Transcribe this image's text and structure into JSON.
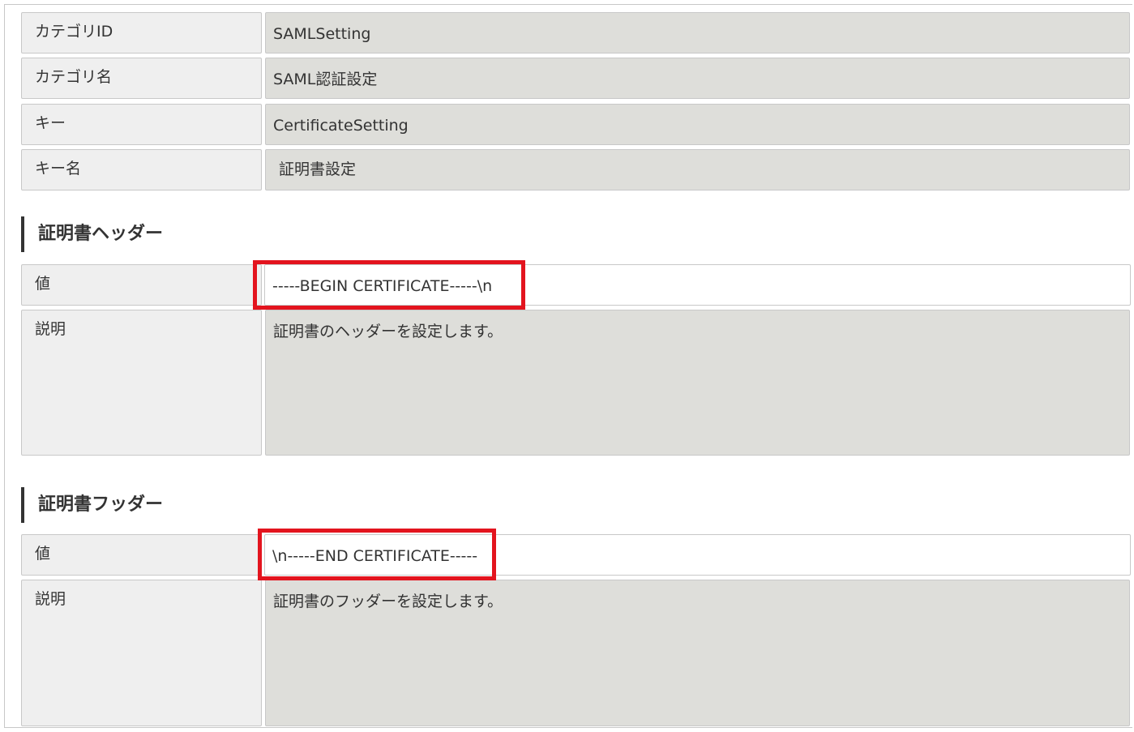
{
  "fields": {
    "category_id": {
      "label": "カテゴリID",
      "value": "SAMLSetting"
    },
    "category_name": {
      "label": "カテゴリ名",
      "value": "SAML認証設定"
    },
    "key": {
      "label": "キー",
      "value": "CertificateSetting"
    },
    "key_name": {
      "label": "キー名",
      "value": "証明書設定"
    }
  },
  "sections": [
    {
      "title": "証明書ヘッダー",
      "value_label": "値",
      "value": "-----BEGIN CERTIFICATE-----\\n",
      "description_label": "説明",
      "description": "証明書のヘッダーを設定します。"
    },
    {
      "title": "証明書フッダー",
      "value_label": "値",
      "value": "\\n-----END CERTIFICATE-----",
      "description_label": "説明",
      "description": "証明書のフッダーを設定します。"
    }
  ],
  "colors": {
    "highlight": "#e3141e",
    "label_bg": "#efefef",
    "readonly_bg": "#dededa"
  }
}
